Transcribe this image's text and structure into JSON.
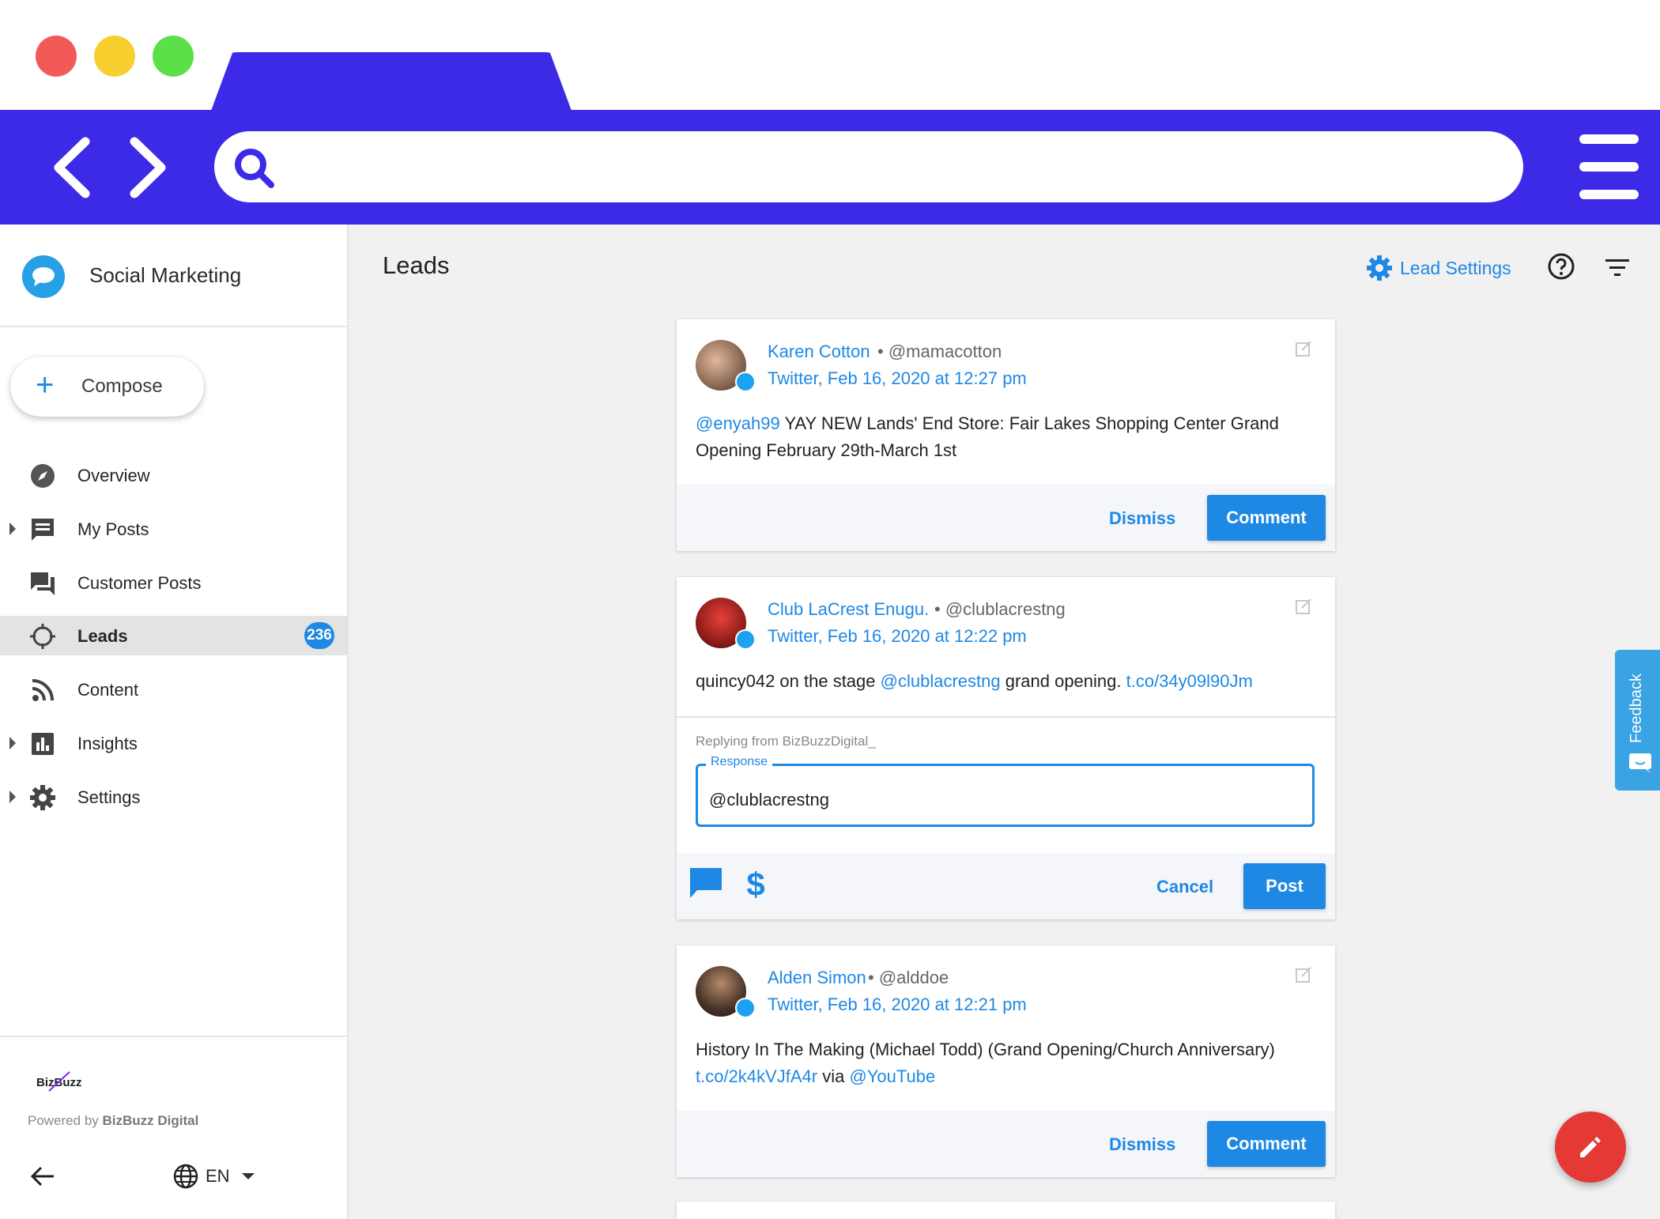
{
  "colors": {
    "chrome": "#3d2ae7",
    "accent": "#1e88e5",
    "fab": "#e53935",
    "feedback": "#3aa3e3",
    "dot_red": "#f25a5a",
    "dot_yellow": "#f7cf2f",
    "dot_green": "#5ce04a"
  },
  "app": {
    "title": "Social Marketing"
  },
  "sidebar": {
    "compose_label": "Compose",
    "items": [
      {
        "label": "Overview",
        "icon": "compass-icon"
      },
      {
        "label": "My Posts",
        "icon": "message-icon"
      },
      {
        "label": "Customer Posts",
        "icon": "forum-icon"
      },
      {
        "label": "Leads",
        "icon": "crosshair-icon",
        "badge": "236"
      },
      {
        "label": "Content",
        "icon": "rss-icon"
      },
      {
        "label": "Insights",
        "icon": "bar-chart-icon"
      },
      {
        "label": "Settings",
        "icon": "gear-icon"
      }
    ],
    "footer": {
      "logo_text": "BizBuzz",
      "powered_prefix": "Powered by ",
      "powered_brand": "BizBuzz Digital",
      "language": "EN"
    }
  },
  "header": {
    "title": "Leads",
    "lead_settings_label": "Lead Settings"
  },
  "leads": [
    {
      "author": "Karen Cotton",
      "handle": "• @mamacotton",
      "meta": "Twitter, Feb 16, 2020 at 12:27 pm",
      "mention": "@enyah99",
      "text": " YAY NEW Lands' End Store: Fair Lakes Shopping Center Grand Opening February 29th-March 1st",
      "dismiss_label": "Dismiss",
      "comment_label": "Comment"
    },
    {
      "author": "Club LaCrest Enugu.",
      "handle": "• @clublacrestng",
      "meta": "Twitter, Feb 16, 2020 at 12:22 pm",
      "text_a": "quincy042 on the stage ",
      "mention": "@clublacrestng",
      "text_b": " grand opening. ",
      "link": "t.co/34y09l90Jm",
      "reply_from": "Replying from BizBuzzDigital_",
      "response_label": "Response",
      "response_value": "@clublacrestng",
      "cancel_label": "Cancel",
      "post_label": "Post"
    },
    {
      "author": "Alden Simon",
      "handle": "• @alddoe",
      "meta": "Twitter, Feb 16, 2020 at 12:21 pm",
      "text": "History In The Making (Michael Todd) (Grand Opening/Church Anniversary) ",
      "link": "t.co/2k4kVJfA4r",
      "via": " via ",
      "mention": "@YouTube",
      "dismiss_label": "Dismiss",
      "comment_label": "Comment"
    }
  ],
  "feedback_label": "Feedback"
}
